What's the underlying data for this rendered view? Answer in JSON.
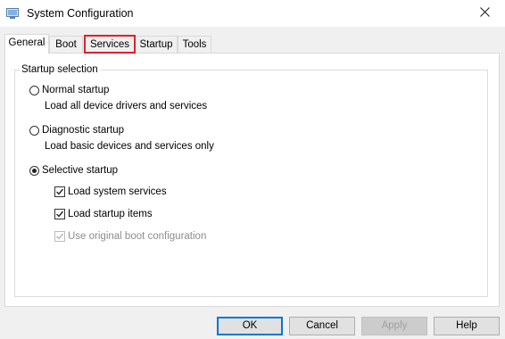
{
  "window": {
    "title": "System Configuration",
    "close_icon": "close-icon"
  },
  "tabs": [
    {
      "label": "General",
      "active": true
    },
    {
      "label": "Boot",
      "active": false
    },
    {
      "label": "Services",
      "active": false,
      "highlighted": true
    },
    {
      "label": "Startup",
      "active": false
    },
    {
      "label": "Tools",
      "active": false
    }
  ],
  "startup_selection": {
    "title": "Startup selection",
    "options": [
      {
        "label": "Normal startup",
        "description": "Load all device drivers and services",
        "selected": false
      },
      {
        "label": "Diagnostic startup",
        "description": "Load basic devices and services only",
        "selected": false
      },
      {
        "label": "Selective startup",
        "description": "",
        "selected": true
      }
    ],
    "checkboxes": [
      {
        "label": "Load system services",
        "checked": true,
        "enabled": true
      },
      {
        "label": "Load startup items",
        "checked": true,
        "enabled": true
      },
      {
        "label": "Use original boot configuration",
        "checked": true,
        "enabled": false
      }
    ]
  },
  "buttons": {
    "ok": "OK",
    "cancel": "Cancel",
    "apply": "Apply",
    "help": "Help"
  },
  "colors": {
    "highlight": "#e0202a",
    "default_button_border": "#0078d7"
  }
}
